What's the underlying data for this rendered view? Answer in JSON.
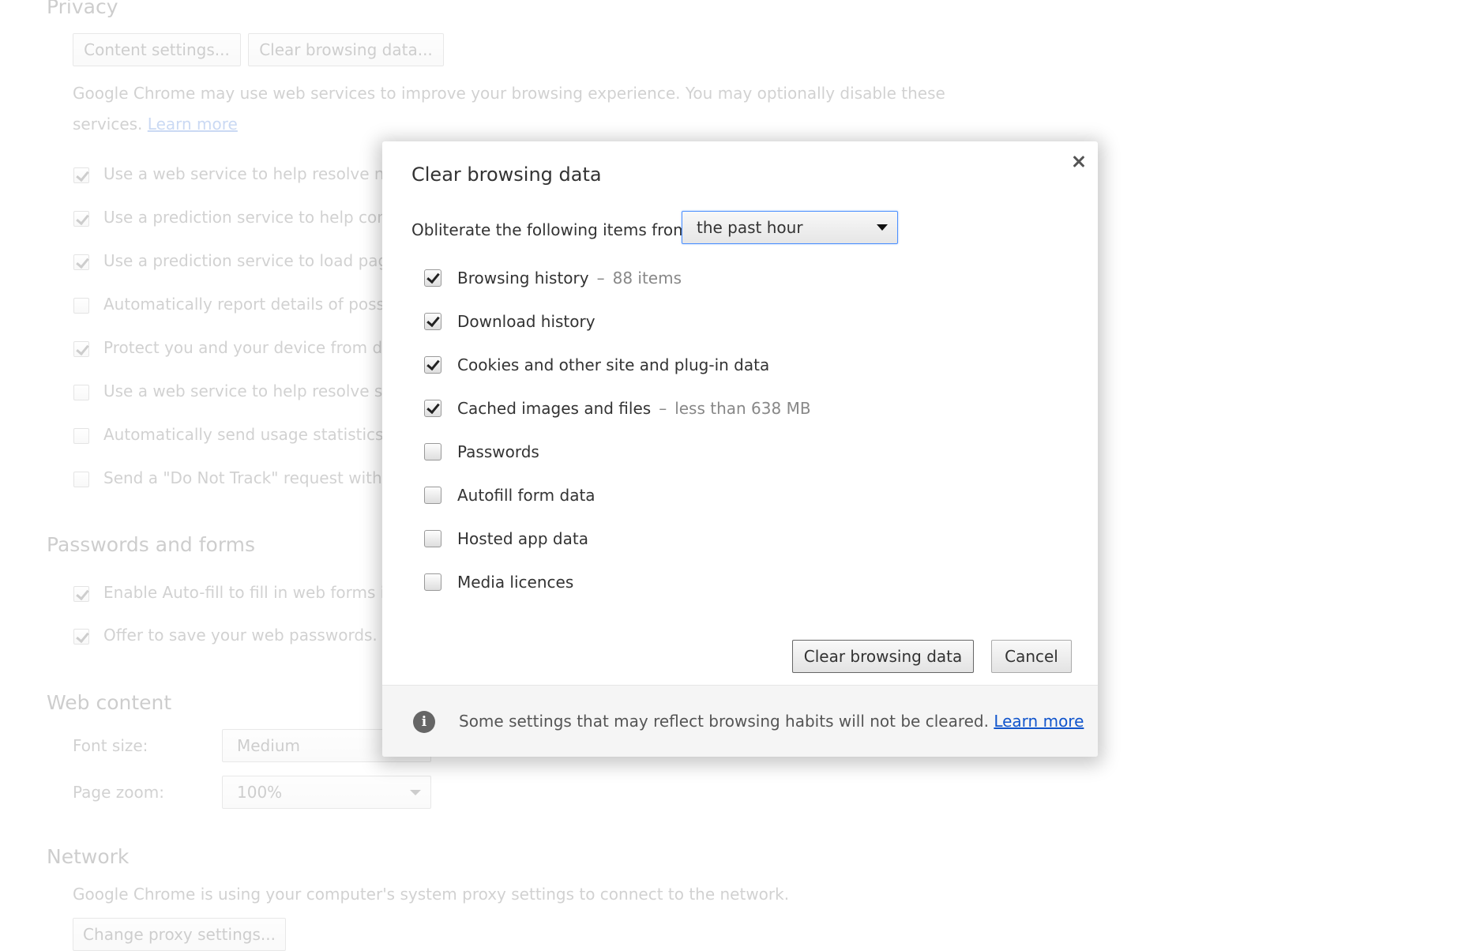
{
  "background": {
    "privacy": {
      "heading": "Privacy",
      "buttons": [
        "Content settings...",
        "Clear browsing data..."
      ],
      "description": "Google Chrome may use web services to improve your browsing experience. You may optionally disable these",
      "description_line2": "services.",
      "learn_more": "Learn more",
      "options": [
        {
          "label": "Use a web service to help resolve navigation errors",
          "checked": true
        },
        {
          "label": "Use a prediction service to help complete searches and URLs typed in the address bar",
          "checked": true
        },
        {
          "label": "Use a prediction service to load pages more quickly",
          "checked": true
        },
        {
          "label": "Automatically report details of possible security incidents to Google",
          "checked": false
        },
        {
          "label": "Protect you and your device from dangerous sites",
          "checked": true
        },
        {
          "label": "Use a web service to help resolve spelling errors",
          "checked": false
        },
        {
          "label": "Automatically send usage statistics and crash reports to Google",
          "checked": false
        },
        {
          "label": "Send a \"Do Not Track\" request with your browsing traffic",
          "checked": false
        }
      ]
    },
    "passwords": {
      "heading": "Passwords and forms",
      "options": [
        {
          "label": "Enable Auto-fill to fill in web forms in a single click.",
          "checked": true
        },
        {
          "label": "Offer to save your web passwords. Manage passwords",
          "checked": true
        }
      ]
    },
    "web_content": {
      "heading": "Web content",
      "font_size_label": "Font size:",
      "font_size_value": "Medium",
      "page_zoom_label": "Page zoom:",
      "page_zoom_value": "100%"
    },
    "network": {
      "heading": "Network",
      "description": "Google Chrome is using your computer's system proxy settings to connect to the network.",
      "button": "Change proxy settings..."
    }
  },
  "dialog": {
    "title": "Clear browsing data",
    "close_icon": "close-icon",
    "time_range_label": "Obliterate the following items from:",
    "time_range_value": "the past hour",
    "items": [
      {
        "label": "Browsing history",
        "detail": "88 items",
        "checked": true
      },
      {
        "label": "Download history",
        "detail": "",
        "checked": true
      },
      {
        "label": "Cookies and other site and plug-in data",
        "detail": "",
        "checked": true
      },
      {
        "label": "Cached images and files",
        "detail": "less than 638 MB",
        "checked": true
      },
      {
        "label": "Passwords",
        "detail": "",
        "checked": false
      },
      {
        "label": "Autofill form data",
        "detail": "",
        "checked": false
      },
      {
        "label": "Hosted app data",
        "detail": "",
        "checked": false
      },
      {
        "label": "Media licences",
        "detail": "",
        "checked": false
      }
    ],
    "separator": "–",
    "clear_button": "Clear browsing data",
    "cancel_button": "Cancel",
    "footer": {
      "icon": "info-icon",
      "icon_glyph": "i",
      "text": "Some settings that may reflect browsing habits will not be cleared.",
      "link": "Learn more"
    }
  }
}
